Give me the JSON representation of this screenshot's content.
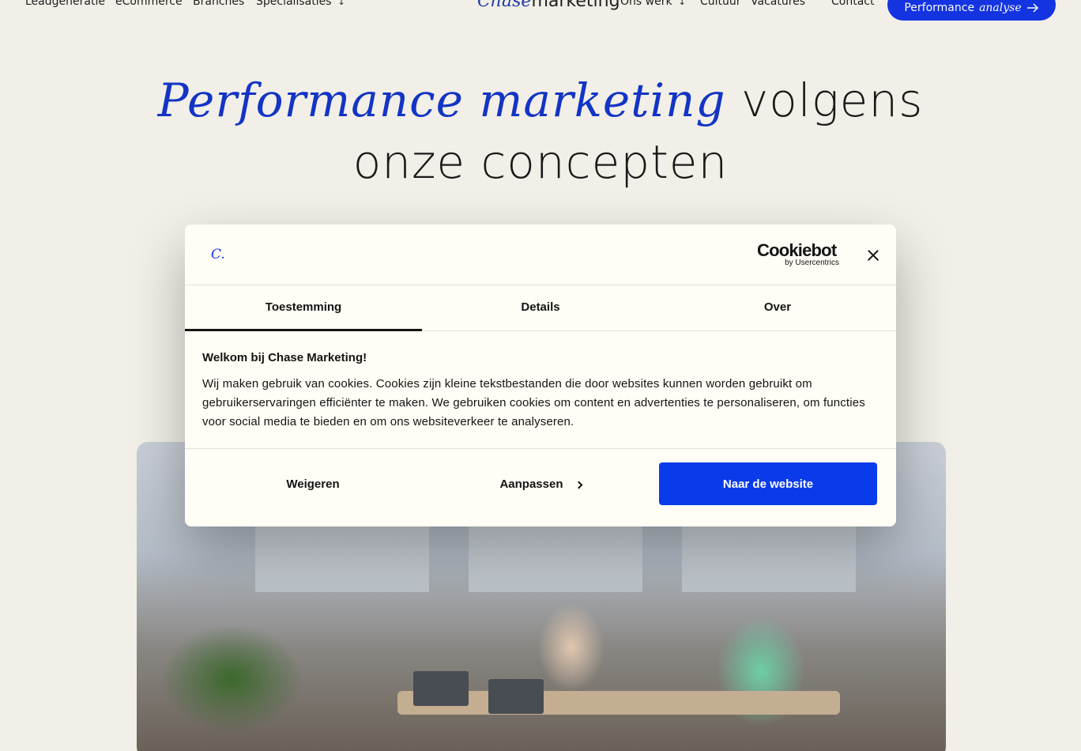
{
  "nav": {
    "left": [
      {
        "label": "Leadgeneratie"
      },
      {
        "label": "eCommerce"
      },
      {
        "label": "Branches"
      },
      {
        "label": "Specialisaties",
        "chevron": "↓"
      }
    ],
    "logo": {
      "script": "Chase",
      "plain": "marketing"
    },
    "right": [
      {
        "label": "Ons werk",
        "chevron": "↓"
      },
      {
        "label": "Cultuur"
      },
      {
        "label": "Vacatures"
      },
      {
        "label": "Contact"
      }
    ],
    "cta": {
      "label": "Performance",
      "label_italic": "analyse",
      "icon": "arrow-right-icon"
    }
  },
  "hero": {
    "accent": "Performance marketing",
    "rest_line1": " volgens",
    "line2": "onze concepten"
  },
  "cookie_dialog": {
    "brand_mark": "C.",
    "provider_logo": {
      "main": "Cookiebot",
      "sub": "by Usercentrics"
    },
    "close_icon": "close-icon",
    "tabs": [
      {
        "label": "Toestemming",
        "active": true
      },
      {
        "label": "Details",
        "active": false
      },
      {
        "label": "Over",
        "active": false
      }
    ],
    "title": "Welkom bij Chase Marketing!",
    "body": "Wij maken gebruik van cookies. Cookies zijn kleine tekstbestanden die door websites kunnen worden gebruikt om gebruikerservaringen efficiënter te maken. We gebruiken cookies om content en advertenties te personaliseren, om functies voor social media te bieden en om ons websiteverkeer te analyseren.",
    "buttons": {
      "decline": "Weigeren",
      "customize": "Aanpassen",
      "accept": "Naar de website"
    }
  },
  "colors": {
    "accent_blue": "#0a3bea",
    "dialog_bg": "#fffdf5",
    "page_bg": "#f6f4ec"
  }
}
